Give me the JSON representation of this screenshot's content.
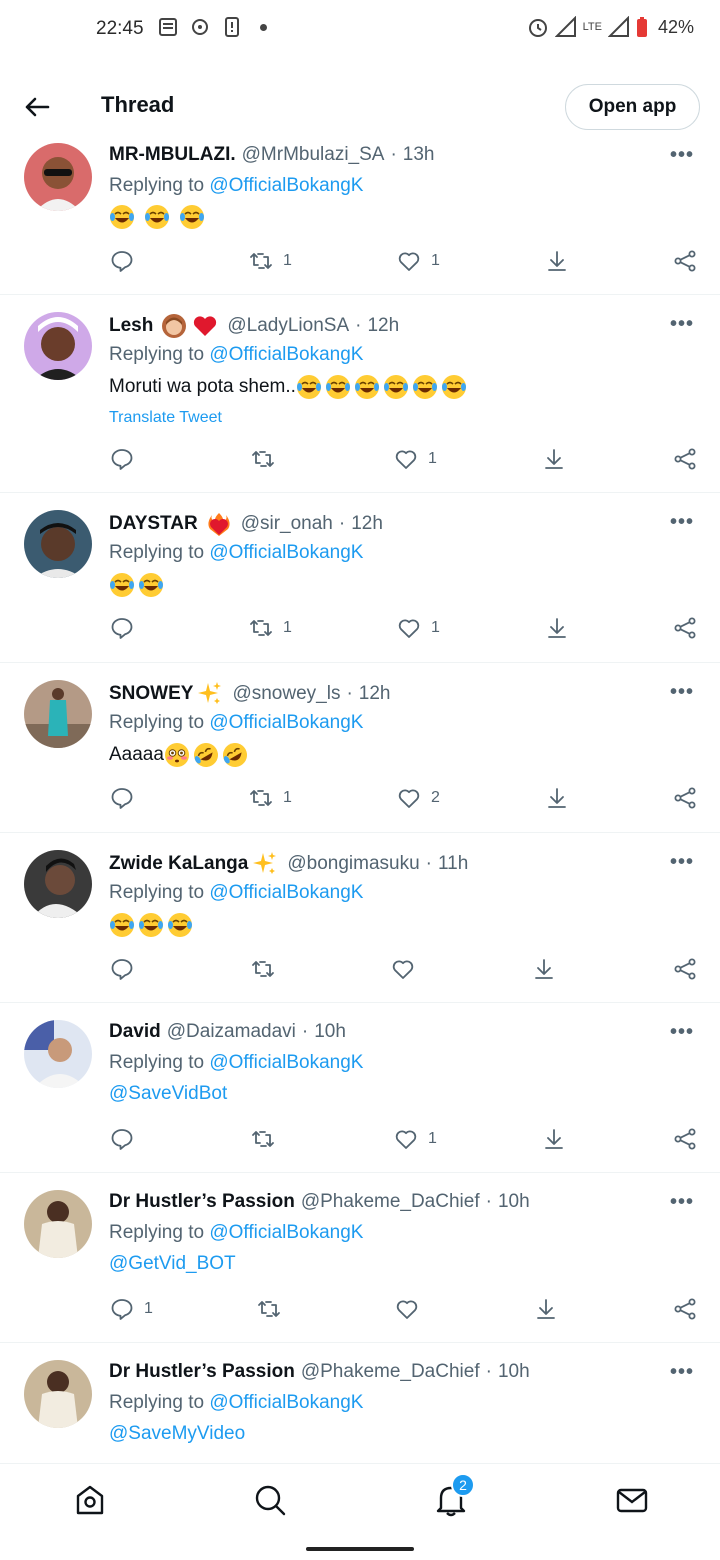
{
  "status_bar": {
    "time": "22:45",
    "network": "LTE",
    "battery": "42%"
  },
  "header": {
    "title": "Thread",
    "open_app_label": "Open app"
  },
  "replying_prefix": "Replying to",
  "tweets": [
    {
      "name": "MR-MBULAZI.",
      "handle": "@MrMbulazi_SA",
      "time": "13h",
      "replying_to": "@OfficialBokangK",
      "body": "",
      "body_emojis": [
        "joy",
        "joy",
        "joy"
      ],
      "replies": "",
      "retweets": "1",
      "likes": "1"
    },
    {
      "name": "Lesh",
      "name_emojis": [
        "woman",
        "heart"
      ],
      "handle": "@LadyLionSA",
      "time": "12h",
      "replying_to": "@OfficialBokangK",
      "body": "Moruti wa pota shem..",
      "body_emojis": [
        "joy",
        "joy",
        "joy",
        "joy",
        "joy",
        "joy"
      ],
      "translate": "Translate Tweet",
      "replies": "",
      "retweets": "",
      "likes": "1"
    },
    {
      "name": "DAYSTAR",
      "name_emojis": [
        "fireheart"
      ],
      "handle": "@sir_onah",
      "time": "12h",
      "replying_to": "@OfficialBokangK",
      "body": "",
      "body_emojis": [
        "joy",
        "joy"
      ],
      "replies": "",
      "retweets": "1",
      "likes": "1"
    },
    {
      "name": "SNOWEY",
      "name_emojis": [
        "sparkles"
      ],
      "handle": "@snowey_ls",
      "time": "12h",
      "replying_to": "@OfficialBokangK",
      "body": "Aaaaa",
      "body_emojis": [
        "flushed",
        "rofl",
        "rofl"
      ],
      "replies": "",
      "retweets": "1",
      "likes": "2"
    },
    {
      "name": "Zwide KaLanga",
      "name_emojis": [
        "sparkles"
      ],
      "handle": "@bongimasuku",
      "time": "11h",
      "replying_to": "@OfficialBokangK",
      "body": "",
      "body_emojis": [
        "joy",
        "joy",
        "joy"
      ],
      "replies": "",
      "retweets": "",
      "likes": ""
    },
    {
      "name": "David",
      "handle": "@Daizamadavi",
      "time": "10h",
      "replying_to": "@OfficialBokangK",
      "body_link": "@SaveVidBot",
      "replies": "",
      "retweets": "",
      "likes": "1"
    },
    {
      "name": "Dr Hustler’s Passion",
      "handle": "@Phakeme_DaChief",
      "time": "10h",
      "replying_to": "@OfficialBokangK",
      "body_link": "@GetVid_BOT",
      "replies": "1",
      "retweets": "",
      "likes": ""
    },
    {
      "name": "Dr Hustler’s Passion",
      "handle": "@Phakeme_DaChief",
      "time": "10h",
      "replying_to": "@OfficialBokangK",
      "body_link": "@SaveMyVideo"
    }
  ],
  "bottom_nav": {
    "items": [
      "home-icon",
      "search-icon",
      "notifications-icon",
      "messages-icon"
    ],
    "notification_badge": "2"
  },
  "colors": {
    "accent": "#1d9bf0",
    "secondary_text": "#536471",
    "divider": "#eff3f4"
  }
}
